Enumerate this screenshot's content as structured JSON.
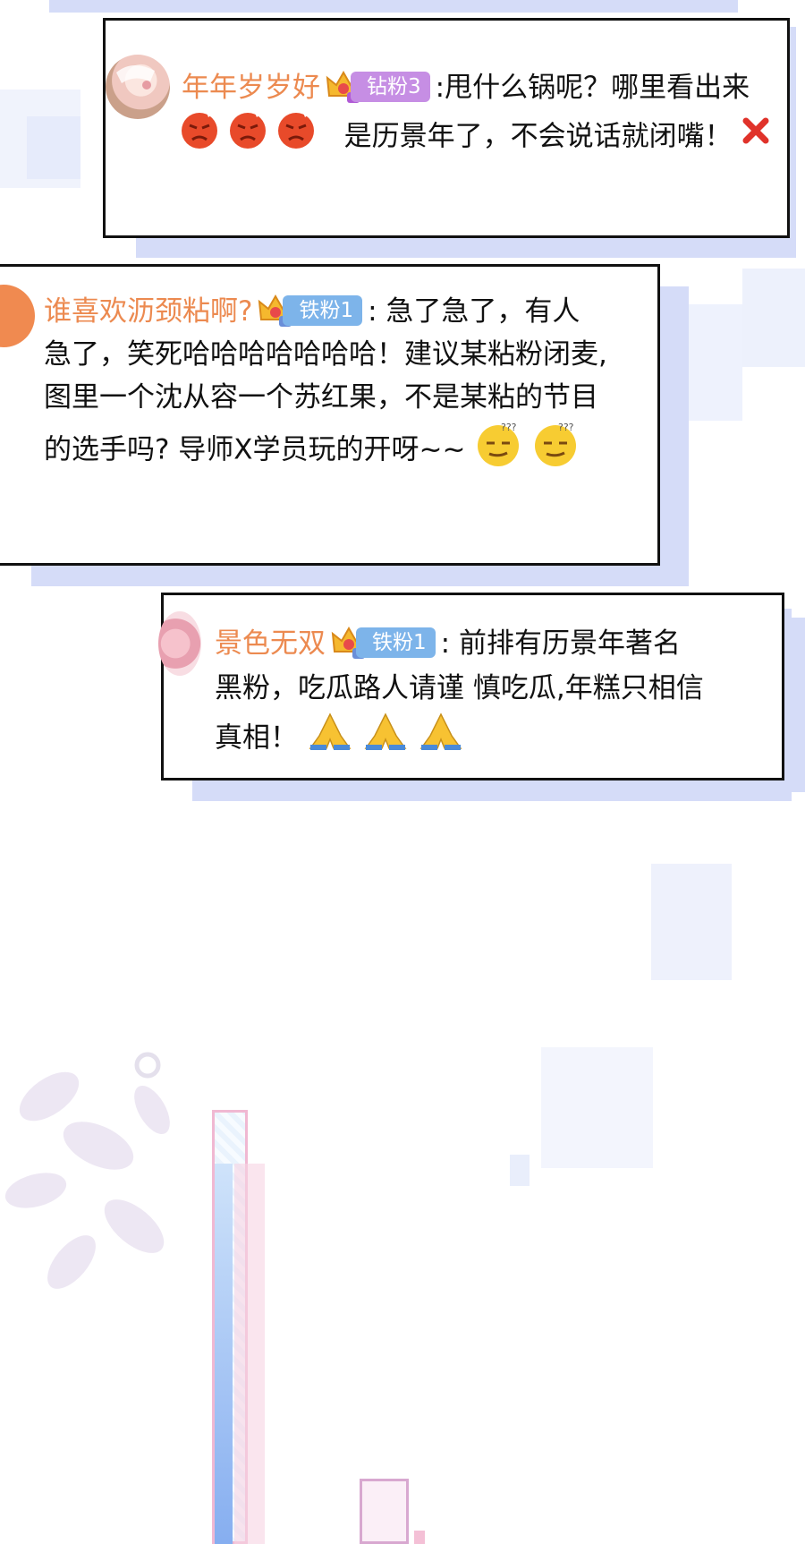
{
  "comments": [
    {
      "username": "年年岁岁好",
      "badge_label": "钻粉3",
      "lines": [
        ":甩什么锅呢？哪里看出来",
        "是历景年了，不会说话就闭嘴！"
      ],
      "emojis": [
        "angry-face-icon",
        "angry-face-icon",
        "angry-face-icon",
        "cross-mark-icon"
      ]
    },
    {
      "username": "谁喜欢沥颈粘啊?",
      "badge_label": "铁粉1",
      "lines": [
        ":  急了急了，有人",
        "急了，笑死哈哈哈哈哈哈哈！建议某粘粉闭麦,",
        "图里一个沈从容一个苏红果，不是某粘的节目",
        "的选手吗? 导师X学员玩的开呀~~"
      ],
      "emojis": [
        "smirk-face-icon",
        "smirk-face-icon"
      ]
    },
    {
      "username": "景色无双",
      "badge_label": "铁粉1",
      "lines": [
        ": 前排有历景年著名",
        "黑粉，吃瓜路人请谨 慎吃瓜,年糕只相信",
        "真相！"
      ],
      "emojis": [
        "praying-hands-icon",
        "praying-hands-icon",
        "praying-hands-icon"
      ]
    }
  ],
  "colors": {
    "username": "#ec8a50",
    "badge_diamond": "#c68ee4",
    "badge_iron": "#7db4ea",
    "card_shadow": "#d5dcf8"
  }
}
